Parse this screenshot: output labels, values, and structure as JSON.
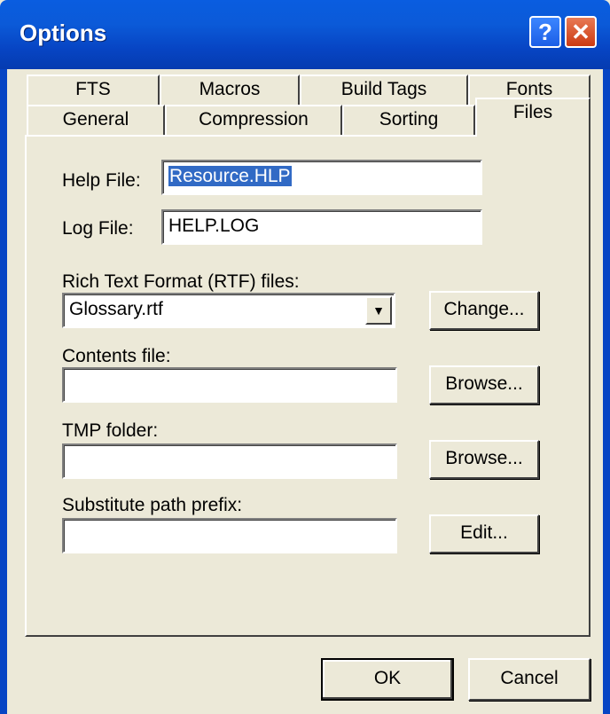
{
  "window": {
    "title": "Options",
    "help_glyph": "?",
    "close_glyph": "✕"
  },
  "tabs": {
    "row1": [
      "FTS",
      "Macros",
      "Build Tags",
      "Fonts"
    ],
    "row2": [
      "General",
      "Compression",
      "Sorting",
      "Files"
    ],
    "active": "Files"
  },
  "form": {
    "help_file_label": "Help File:",
    "help_file_value": "Resource.HLP",
    "log_file_label": "Log File:",
    "log_file_value": "HELP.LOG",
    "rtf_label": "Rich Text Format (RTF) files:",
    "rtf_selected": "Glossary.rtf",
    "change_button": "Change...",
    "contents_label": "Contents file:",
    "contents_value": "",
    "browse_button_1": "Browse...",
    "tmp_label": "TMP folder:",
    "tmp_value": "",
    "browse_button_2": "Browse...",
    "substitute_label": "Substitute path prefix:",
    "substitute_value": "",
    "edit_button": "Edit..."
  },
  "footer": {
    "ok_button": "OK",
    "cancel_button": "Cancel"
  },
  "icons": {
    "dropdown": "chevron-down-icon"
  }
}
